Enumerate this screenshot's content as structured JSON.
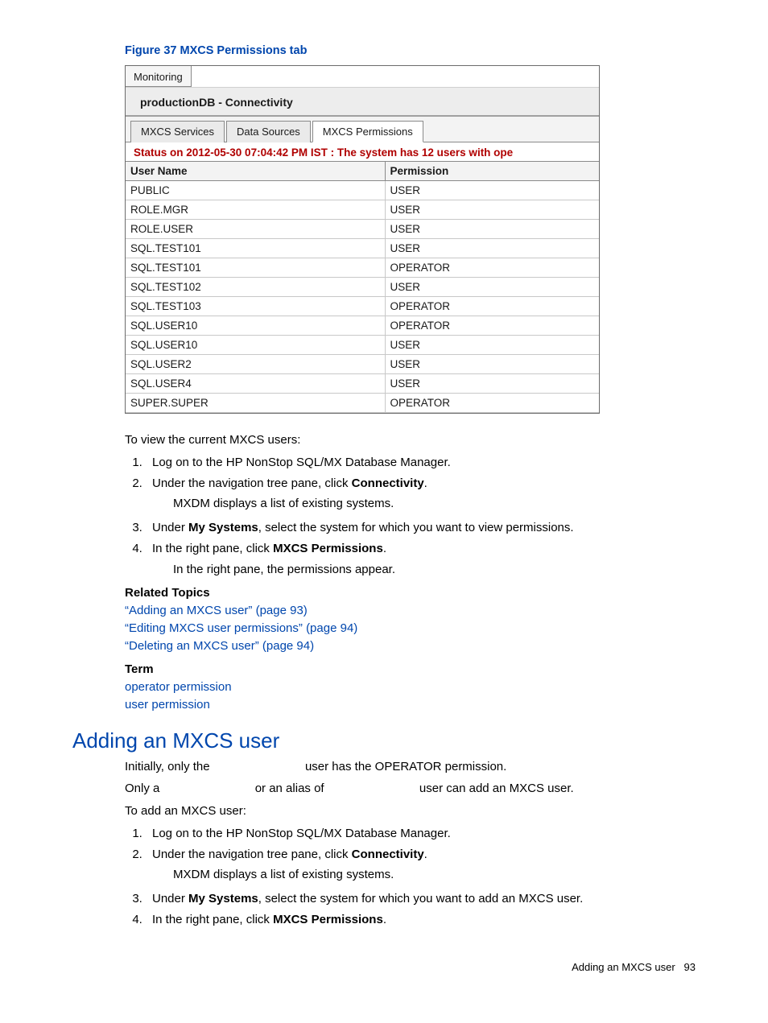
{
  "figure_caption": "Figure 37 MXCS Permissions tab",
  "screenshot": {
    "top_tab": "Monitoring",
    "panel_title": "productionDB - Connectivity",
    "tabs": [
      "MXCS Services",
      "Data Sources",
      "MXCS Permissions"
    ],
    "active_tab_index": 2,
    "status": "Status on 2012-05-30 07:04:42 PM IST : The system has 12 users with ope",
    "table": {
      "headers": [
        "User Name",
        "Permission"
      ],
      "rows": [
        [
          "PUBLIC",
          "USER"
        ],
        [
          "ROLE.MGR",
          "USER"
        ],
        [
          "ROLE.USER",
          "USER"
        ],
        [
          "SQL.TEST101",
          "USER"
        ],
        [
          "SQL.TEST101",
          "OPERATOR"
        ],
        [
          "SQL.TEST102",
          "USER"
        ],
        [
          "SQL.TEST103",
          "OPERATOR"
        ],
        [
          "SQL.USER10",
          "OPERATOR"
        ],
        [
          "SQL.USER10",
          "USER"
        ],
        [
          "SQL.USER2",
          "USER"
        ],
        [
          "SQL.USER4",
          "USER"
        ],
        [
          "SUPER.SUPER",
          "OPERATOR"
        ]
      ]
    }
  },
  "section1": {
    "intro": "To view the current MXCS users:",
    "steps": [
      {
        "text": "Log on to the HP NonStop SQL/MX Database Manager."
      },
      {
        "text_a": "Under the navigation tree pane, click ",
        "bold": "Connectivity",
        "text_b": ".",
        "sub": "MXDM displays a list of existing systems."
      },
      {
        "text_a": "Under ",
        "bold": "My Systems",
        "text_b": ", select the system for which you want to view permissions."
      },
      {
        "text_a": "In the right pane, click ",
        "bold": "MXCS Permissions",
        "text_b": ".",
        "sub": "In the right pane, the permissions appear."
      }
    ],
    "related_head": "Related Topics",
    "related_links": [
      "“Adding an MXCS user” (page 93)",
      "“Editing MXCS user permissions” (page 94)",
      "“Deleting an MXCS user” (page 94)"
    ],
    "term_head": "Term",
    "term_links": [
      "operator permission",
      "user permission"
    ]
  },
  "section2": {
    "heading": "Adding an MXCS user",
    "para1_a": "Initially, only the ",
    "para1_b": " user has the OPERATOR permission.",
    "para2_a": "Only a ",
    "para2_b": " or an alias of ",
    "para2_c": " user can add an MXCS user.",
    "intro": "To add an MXCS user:",
    "steps": [
      {
        "text": "Log on to the HP NonStop SQL/MX Database Manager."
      },
      {
        "text_a": "Under the navigation tree pane, click ",
        "bold": "Connectivity",
        "text_b": ".",
        "sub": "MXDM displays a list of existing systems."
      },
      {
        "text_a": "Under ",
        "bold": "My Systems",
        "text_b": ", select the system for which you want to add an MXCS user."
      },
      {
        "text_a": "In the right pane, click ",
        "bold": "MXCS Permissions",
        "text_b": "."
      }
    ]
  },
  "footer": {
    "text": "Adding an MXCS user",
    "pageno": "93"
  }
}
